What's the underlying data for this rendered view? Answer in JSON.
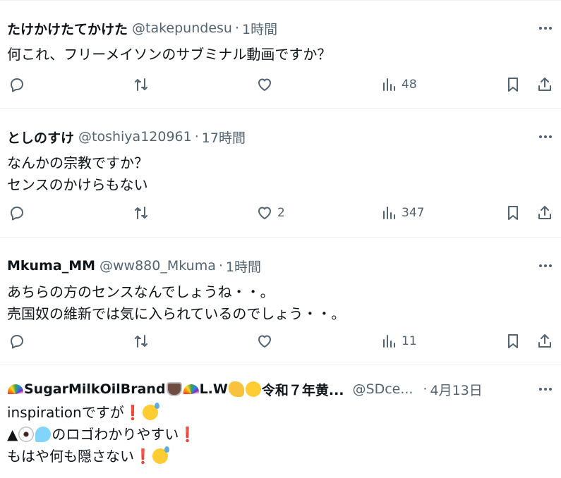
{
  "tweets": [
    {
      "name": "たけかけたてかけた",
      "handle": "@takepundesu",
      "dot": "·",
      "time": "1時間",
      "lines": [
        "何これ、フリーメイソンのサブミナル動画ですか？"
      ],
      "likes": "",
      "views": "48"
    },
    {
      "name": "としのすけ",
      "handle": "@toshiya120961",
      "dot": "·",
      "time": "17時間",
      "lines": [
        "なんかの宗教ですか？",
        "センスのかけらもない"
      ],
      "likes": "2",
      "views": "347"
    },
    {
      "name": "Mkuma_MM",
      "handle": "@ww880_Mkuma",
      "dot": "·",
      "time": "1時間",
      "lines": [
        "あちらの方のセンスなんでしょうね・・。",
        "売国奴の維新では気に入られているのでしょう・・。"
      ],
      "likes": "",
      "views": "11"
    },
    {
      "name_part1": "SugarMilkOilBrand",
      "name_part2": "L.W",
      "name_part3": "令和７年黄...",
      "handle": "@SDce...",
      "dot": "·",
      "time": "4月13日",
      "line1": "inspirationですが",
      "line2_text": "のロゴわかりやすい",
      "line2_prefix": "▲",
      "line3": "もはや何も隠さない",
      "exclamation": "❗"
    }
  ],
  "icons": {
    "reply": "reply-icon",
    "retweet": "retweet-icon",
    "like": "heart-icon",
    "views": "views-icon",
    "bookmark": "bookmark-icon",
    "share": "share-icon",
    "more": "more-icon"
  },
  "colors": {
    "text": "#0f1419",
    "muted": "#536471",
    "divider": "#eff3f4"
  }
}
